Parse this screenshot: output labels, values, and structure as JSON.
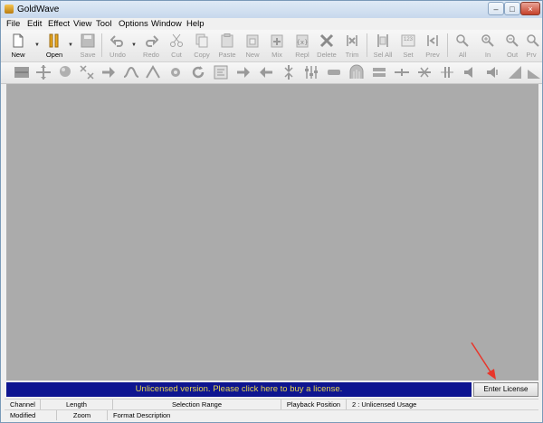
{
  "window": {
    "title": "GoldWave",
    "min_glyph": "–",
    "max_glyph": "□",
    "close_glyph": "×"
  },
  "menu": [
    "File",
    "Edit",
    "Effect",
    "View",
    "Tool",
    "Options",
    "Window",
    "Help"
  ],
  "toolbar": {
    "new": "New",
    "open": "Open",
    "save": "Save",
    "undo": "Undo",
    "redo": "Redo",
    "cut": "Cut",
    "copy": "Copy",
    "paste": "Paste",
    "paste_new": "New",
    "mix": "Mix",
    "replace": "Repl",
    "delete": "Delete",
    "trim": "Trim",
    "sel_all": "Sel All",
    "set": "Set",
    "prev": "Prev",
    "zoom_all": "All",
    "zoom_in": "In",
    "zoom_out": "Out",
    "zoom_prev": "Prv",
    "set_icon_text": "123"
  },
  "license": {
    "message": "Unlicensed version. Please click here to buy a license.",
    "button": "Enter License"
  },
  "status": {
    "channel": "Channel",
    "length": "Length",
    "selection_range": "Selection Range",
    "playback_position": "Playback Position",
    "usage": "2 : Unlicensed Usage",
    "modified": "Modified",
    "zoom": "Zoom",
    "format": "Format Description"
  }
}
